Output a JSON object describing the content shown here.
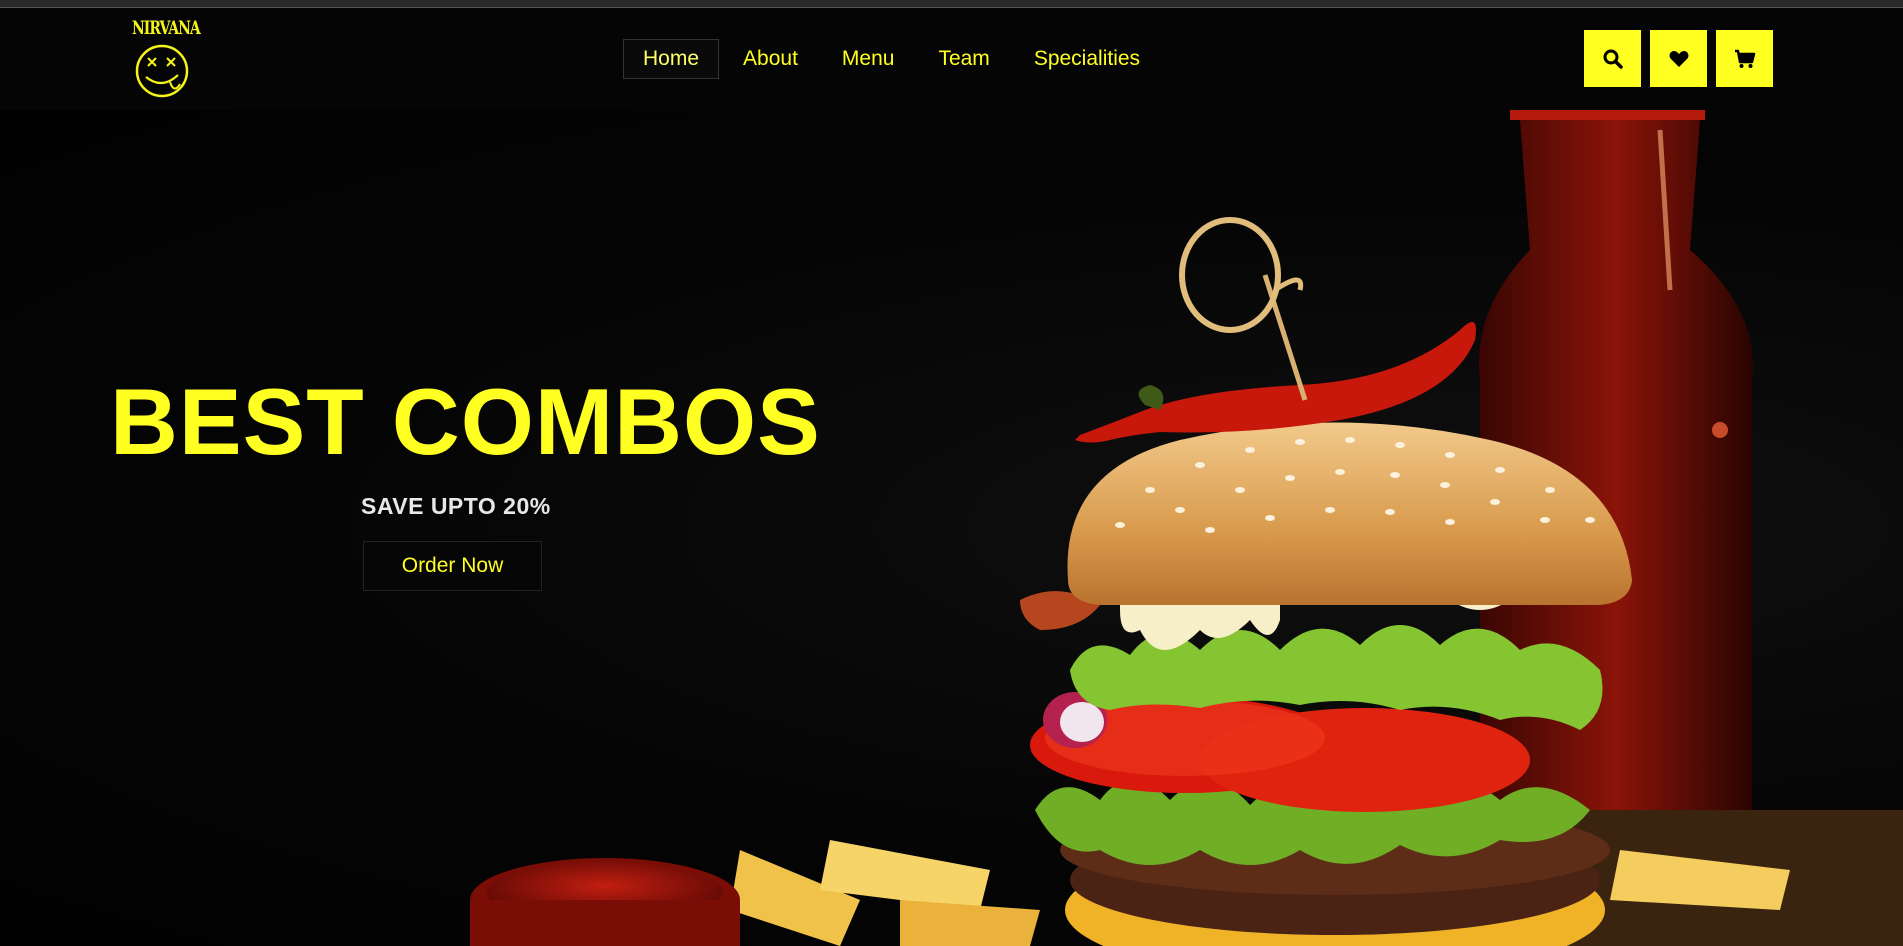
{
  "brand": {
    "logo_text": "NIRVANA"
  },
  "nav": {
    "items": [
      {
        "label": "Home",
        "active": true
      },
      {
        "label": "About"
      },
      {
        "label": "Menu"
      },
      {
        "label": "Team"
      },
      {
        "label": "Specialities"
      }
    ]
  },
  "actions": {
    "search_icon": "search-icon",
    "wishlist_icon": "heart-icon",
    "cart_icon": "cart-icon"
  },
  "hero": {
    "title": "BEST COMBOS",
    "subtitle": "SAVE UPTO 20%",
    "cta_label": "Order Now"
  },
  "colors": {
    "accent": "#ffff22",
    "background": "#040404"
  }
}
